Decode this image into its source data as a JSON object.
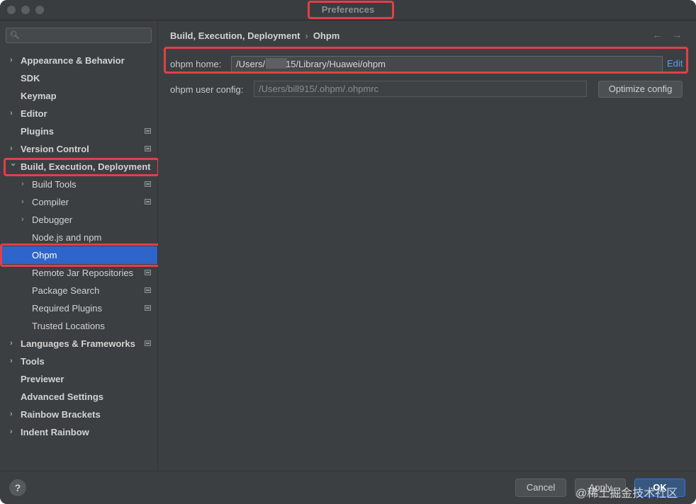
{
  "window": {
    "title": "Preferences"
  },
  "search": {
    "placeholder": ""
  },
  "sidebar": {
    "items": [
      {
        "label": "Appearance & Behavior",
        "level": 0,
        "expandable": true,
        "expanded": false,
        "bold": true,
        "tag": false,
        "selected": false
      },
      {
        "label": "SDK",
        "level": 0,
        "expandable": false,
        "bold": true,
        "tag": false,
        "selected": false
      },
      {
        "label": "Keymap",
        "level": 0,
        "expandable": false,
        "bold": true,
        "tag": false,
        "selected": false
      },
      {
        "label": "Editor",
        "level": 0,
        "expandable": true,
        "expanded": false,
        "bold": true,
        "tag": false,
        "selected": false
      },
      {
        "label": "Plugins",
        "level": 0,
        "expandable": false,
        "bold": true,
        "tag": true,
        "selected": false
      },
      {
        "label": "Version Control",
        "level": 0,
        "expandable": true,
        "expanded": false,
        "bold": true,
        "tag": true,
        "selected": false
      },
      {
        "label": "Build, Execution, Deployment",
        "level": 0,
        "expandable": true,
        "expanded": true,
        "bold": true,
        "tag": false,
        "selected": false
      },
      {
        "label": "Build Tools",
        "level": 1,
        "expandable": true,
        "expanded": false,
        "bold": false,
        "tag": true,
        "selected": false
      },
      {
        "label": "Compiler",
        "level": 1,
        "expandable": true,
        "expanded": false,
        "bold": false,
        "tag": true,
        "selected": false
      },
      {
        "label": "Debugger",
        "level": 1,
        "expandable": true,
        "expanded": false,
        "bold": false,
        "tag": false,
        "selected": false
      },
      {
        "label": "Node.js and npm",
        "level": 1,
        "expandable": false,
        "bold": false,
        "tag": false,
        "selected": false
      },
      {
        "label": "Ohpm",
        "level": 1,
        "expandable": false,
        "bold": false,
        "tag": false,
        "selected": true
      },
      {
        "label": "Remote Jar Repositories",
        "level": 1,
        "expandable": false,
        "bold": false,
        "tag": true,
        "selected": false
      },
      {
        "label": "Package Search",
        "level": 1,
        "expandable": false,
        "bold": false,
        "tag": true,
        "selected": false
      },
      {
        "label": "Required Plugins",
        "level": 1,
        "expandable": false,
        "bold": false,
        "tag": true,
        "selected": false
      },
      {
        "label": "Trusted Locations",
        "level": 1,
        "expandable": false,
        "bold": false,
        "tag": false,
        "selected": false
      },
      {
        "label": "Languages & Frameworks",
        "level": 0,
        "expandable": true,
        "expanded": false,
        "bold": true,
        "tag": true,
        "selected": false
      },
      {
        "label": "Tools",
        "level": 0,
        "expandable": true,
        "expanded": false,
        "bold": true,
        "tag": false,
        "selected": false
      },
      {
        "label": "Previewer",
        "level": 0,
        "expandable": false,
        "bold": true,
        "tag": false,
        "selected": false
      },
      {
        "label": "Advanced Settings",
        "level": 0,
        "expandable": false,
        "bold": true,
        "tag": false,
        "selected": false
      },
      {
        "label": "Rainbow Brackets",
        "level": 0,
        "expandable": true,
        "expanded": false,
        "bold": true,
        "tag": false,
        "selected": false
      },
      {
        "label": "Indent Rainbow",
        "level": 0,
        "expandable": true,
        "expanded": false,
        "bold": true,
        "tag": false,
        "selected": false
      }
    ]
  },
  "breadcrumb": {
    "parent": "Build, Execution, Deployment",
    "separator": "›",
    "current": "Ohpm"
  },
  "nav": {
    "back_icon": "arrow-left-icon",
    "forward_icon": "arrow-right-icon"
  },
  "form": {
    "home_label": "ohpm home:",
    "home_value_start": "/Users/l",
    "home_value_end": "15/Library/Huawei/ohpm",
    "edit_link": "Edit",
    "config_label": "ohpm user config:",
    "config_value": "/Users/bill915/.ohpm/.ohpmrc",
    "optimize_button": "Optimize config"
  },
  "footer": {
    "help": "?",
    "cancel": "Cancel",
    "apply": "Apply",
    "ok": "OK"
  },
  "watermark": "@稀土掘金技术社区",
  "colors": {
    "selection": "#2f65ca",
    "highlight_box": "#e0404a",
    "link": "#589df6",
    "panel": "#3c3f41"
  }
}
